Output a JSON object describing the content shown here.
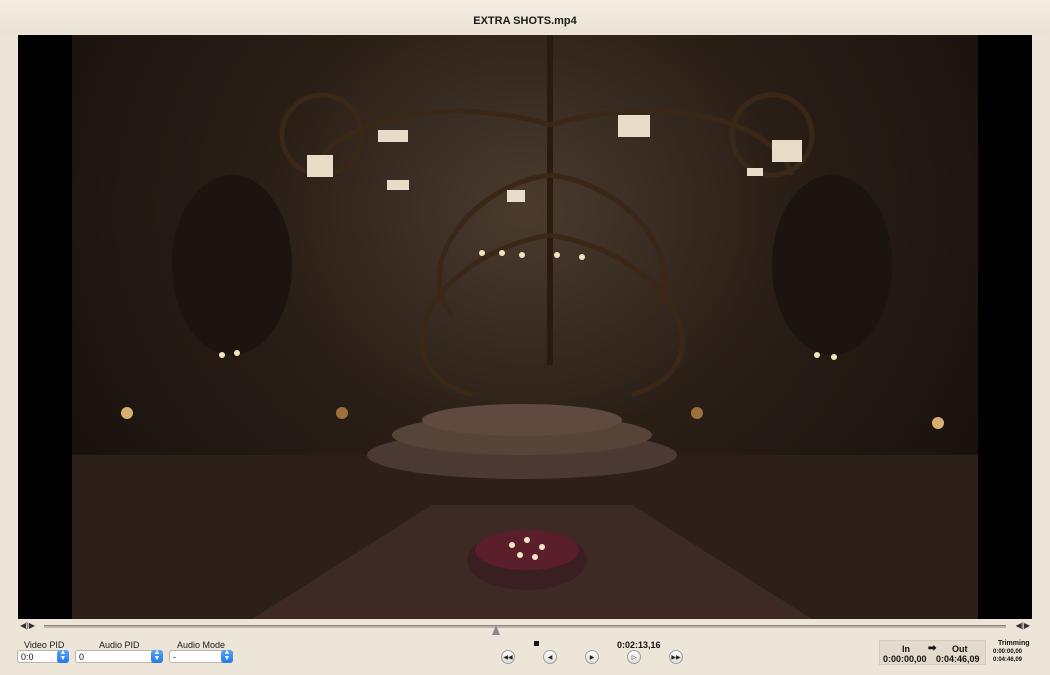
{
  "window": {
    "title": "EXTRA SHOTS.mp4"
  },
  "scrubber": {
    "left_buttons": "◀︎)▶",
    "right_buttons": "◀|▶",
    "position_fraction": 0.47
  },
  "video_pid": {
    "label": "Video PID",
    "value": "0:0"
  },
  "audio_pid": {
    "label": "Audio PID",
    "value": "0"
  },
  "audio_mode": {
    "label": "Audio Mode",
    "value": "-"
  },
  "transport": {
    "rewind_icon": "◀◀",
    "step_back_icon": "◀",
    "play_icon": "▶",
    "step_forward_icon": "▷",
    "fast_forward_icon": "▶▶",
    "current_time": "0:02:13,16"
  },
  "in_out": {
    "in_label": "In",
    "arrow": "➡",
    "out_label": "Out",
    "in_time": "0:00:00,00",
    "out_time": "0:04:46,09"
  },
  "trimming": {
    "label": "Trimming",
    "start": "0:00:00,00",
    "end": "0:04:46,09"
  }
}
